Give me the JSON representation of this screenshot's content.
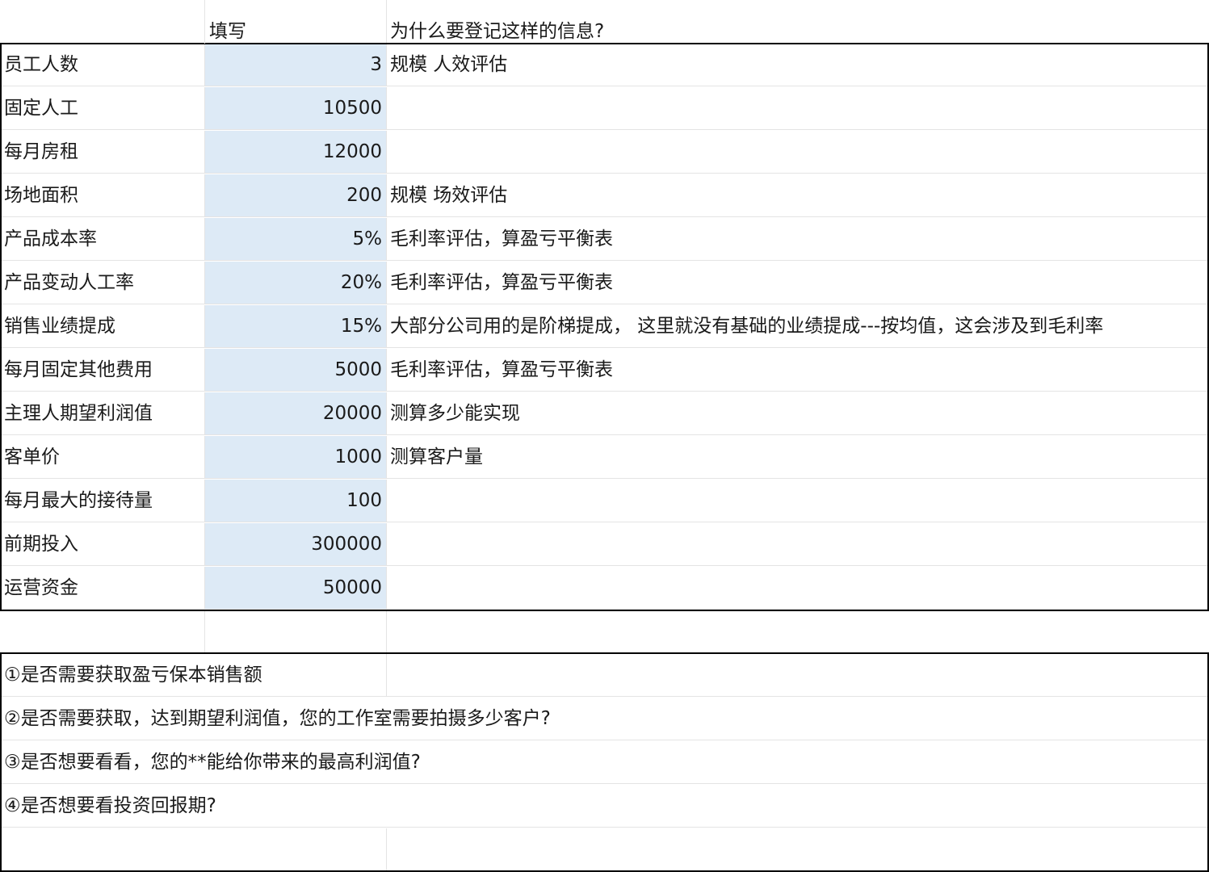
{
  "header": {
    "col_b": "填写",
    "col_c": "为什么要登记这样的信息?"
  },
  "rows": [
    {
      "label": "员工人数",
      "value": "3",
      "note": "规模  人效评估"
    },
    {
      "label": "固定人工",
      "value": "10500",
      "note": ""
    },
    {
      "label": "每月房租",
      "value": "12000",
      "note": ""
    },
    {
      "label": "场地面积",
      "value": "200",
      "note": "规模  场效评估"
    },
    {
      "label": "产品成本率",
      "value": "5%",
      "note": "毛利率评估，算盈亏平衡表"
    },
    {
      "label": "产品变动人工率",
      "value": "20%",
      "note": "毛利率评估，算盈亏平衡表"
    },
    {
      "label": "销售业绩提成",
      "value": "15%",
      "note": "大部分公司用的是阶梯提成，  这里就没有基础的业绩提成---按均值，这会涉及到毛利率"
    },
    {
      "label": "每月固定其他费用",
      "value": "5000",
      "note": "毛利率评估，算盈亏平衡表"
    },
    {
      "label": "主理人期望利润值",
      "value": "20000",
      "note": "测算多少能实现"
    },
    {
      "label": "客单价",
      "value": "1000",
      "note": "测算客户量"
    },
    {
      "label": "每月最大的接待量",
      "value": "100",
      "note": ""
    },
    {
      "label": "前期投入",
      "value": "300000",
      "note": ""
    },
    {
      "label": "运营资金",
      "value": "50000",
      "note": ""
    }
  ],
  "questions": [
    "①是否需要获取盈亏保本销售额",
    "②是否需要获取，达到期望利润值，您的工作室需要拍摄多少客户?",
    "③是否想要看看，您的**能给你带来的最高利润值?",
    "④是否想要看投资回报期?"
  ]
}
